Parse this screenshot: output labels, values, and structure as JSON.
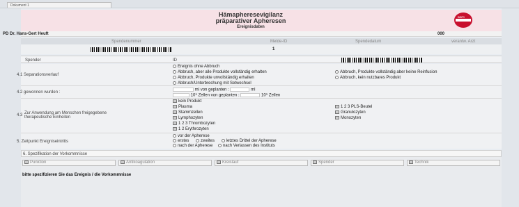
{
  "top_tab": {
    "label": "Dokument 1"
  },
  "header": {
    "title_line1": "Hämapheresevigilanz",
    "title_line2": "präparativer Apheresen",
    "subtitle": "Ereignisdaten",
    "doctor": "PD Dr. Hans-Gert Heuft",
    "code": "000",
    "logo_text": "DGTI"
  },
  "meta": {
    "col_spendenummer": "Spendenummer",
    "col_melde_id": "Melde-ID",
    "col_spendedatum": "Spendedatum",
    "col_arzt": "verantw. Arzt",
    "melde_id_value": "1"
  },
  "spender": {
    "label": "Spender",
    "id_label": "ID"
  },
  "sections": {
    "s41": {
      "label": "4.1 Separationsverlauf",
      "options": [
        "Ereignis ohne Abbruch",
        "Abbruch, aber alle Produkte vollständig erhalten",
        "Abbruch, Produkte unvollständig erhalten",
        "Abbruch/Unterbrechung mit Setwechsel",
        "Abbruch, Produkte vollständig aber keine Reinfusion",
        "Abbruch, kein nutzbares Produkt"
      ]
    },
    "s42": {
      "label": "4.2 gewonnen wurden :",
      "line1_unit": "ml",
      "line1_mid": "von geplanten :",
      "line1_unit2": "ml",
      "line2_unit": "10⁹ Zellen",
      "line2_mid": "von geplanten :",
      "line2_unit2": "10⁹ Zellen"
    },
    "s43": {
      "label_line1": "Zur Anwendung am Menschen freigegebene",
      "label_line2": "therapeutische Einheiten",
      "label_num": "4.3",
      "items_left": [
        "kein Produkt",
        "Plasma",
        "Stammzellen",
        "Lymphozyten",
        "1   2   3   Thrombozyten",
        "1   2   Erythrozyten"
      ],
      "items_right": [
        "1   2   3   PLS-Beutel",
        "Granulozyten",
        "Monozyten"
      ]
    },
    "s5": {
      "label": "5. Zeitpunkt Ereigniseintritts",
      "options_line1": "vor der Apherese",
      "opt_erstes": "erstes",
      "opt_zweites": "zweites",
      "opt_letztes": "letztes Drittel der Apherese",
      "opt_nach": "nach der Apherese",
      "opt_verlassen": "nach Verlassen des Instituts"
    },
    "s6": {
      "label": "6. Spezifikation der Vorkommnisse",
      "tabs": [
        "Punktion",
        "Antikoagulation",
        "Kreislauf",
        "Spender",
        "Technik"
      ],
      "prompt": "bitte spezifizieren Sie das Ereignis / die Vorkommnisse"
    }
  }
}
